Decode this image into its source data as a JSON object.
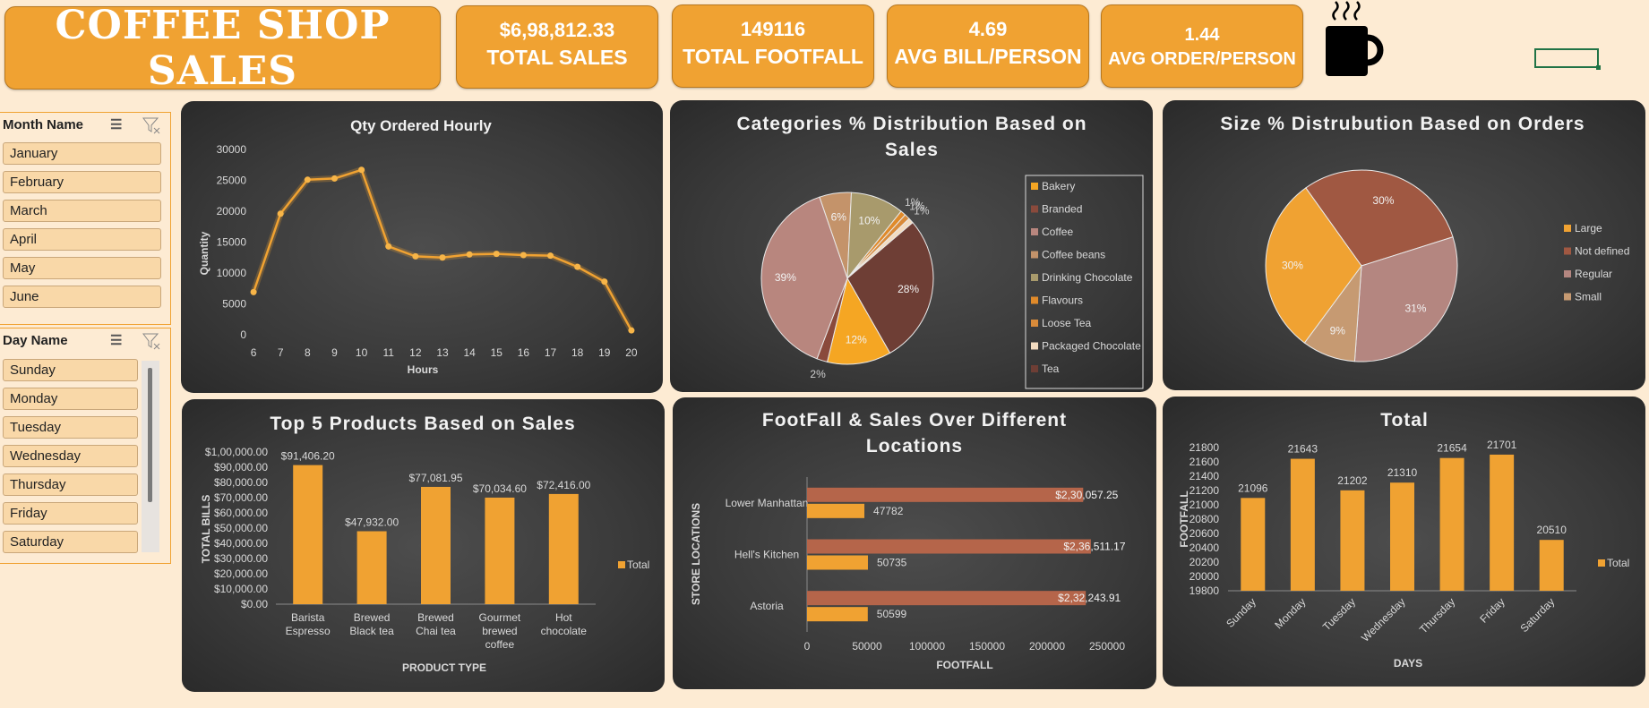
{
  "header": {
    "title": "COFFEE SHOP SALES",
    "kpis": [
      {
        "value": "$6,98,812.33",
        "label": "TOTAL SALES"
      },
      {
        "value": "149116",
        "label": "TOTAL FOOTFALL"
      },
      {
        "value": "4.69",
        "label": "AVG BILL/PERSON"
      },
      {
        "value": "1.44",
        "label": "AVG ORDER/PERSON"
      }
    ]
  },
  "slicers": {
    "month": {
      "title": "Month Name",
      "items": [
        "January",
        "February",
        "March",
        "April",
        "May",
        "June"
      ]
    },
    "day": {
      "title": "Day Name",
      "items": [
        "Sunday",
        "Monday",
        "Tuesday",
        "Wednesday",
        "Thursday",
        "Friday",
        "Saturday"
      ]
    }
  },
  "colors": {
    "accent": "#f0a232",
    "background": "#fdebd3",
    "panel": "#404040"
  },
  "chart_data": [
    {
      "id": "hourly",
      "type": "line",
      "title": "Qty Ordered Hourly",
      "xlabel": "Hours",
      "ylabel": "Quantity",
      "x": [
        "6",
        "7",
        "8",
        "9",
        "10",
        "11",
        "12",
        "13",
        "14",
        "15",
        "16",
        "17",
        "18",
        "19",
        "20"
      ],
      "values": [
        6900,
        19600,
        25100,
        25300,
        26700,
        14300,
        12700,
        12500,
        13000,
        13100,
        12900,
        12800,
        11000,
        8600,
        700
      ],
      "yticks": [
        "0",
        "5000",
        "10000",
        "15000",
        "20000",
        "25000",
        "30000"
      ],
      "ylim": [
        0,
        30000
      ]
    },
    {
      "id": "categories",
      "type": "pie",
      "title": "Categories % Distribution Based on Sales",
      "title_lines": [
        "Categories % Distribution Based on",
        "Sales"
      ],
      "legend_position": "right",
      "slices": [
        {
          "name": "Bakery",
          "value": 12,
          "label": "12%",
          "color": "#f5a623"
        },
        {
          "name": "Branded",
          "value": 2,
          "label": "2%",
          "color": "#8a4a3c"
        },
        {
          "name": "Coffee",
          "value": 39,
          "label": "39%",
          "color": "#b8867e"
        },
        {
          "name": "Coffee beans",
          "value": 6,
          "label": "6%",
          "color": "#c4936a"
        },
        {
          "name": "Drinking Chocolate",
          "value": 10,
          "label": "10%",
          "color": "#a89a6c"
        },
        {
          "name": "Flavours",
          "value": 1,
          "label": "1%",
          "color": "#e08a2a"
        },
        {
          "name": "Loose Tea",
          "value": 1,
          "label": "1%",
          "color": "#d98b3a"
        },
        {
          "name": "Packaged Chocolate",
          "value": 1,
          "label": "1%",
          "color": "#f3dcc0"
        },
        {
          "name": "Tea",
          "value": 28,
          "label": "28%",
          "color": "#6e3e35"
        }
      ]
    },
    {
      "id": "sizes",
      "type": "pie",
      "title": "Size % Distrubution Based on Orders",
      "legend_position": "right",
      "slices": [
        {
          "name": "Large",
          "value": 30,
          "label": "30%",
          "color": "#f0a232"
        },
        {
          "name": "Not defined",
          "value": 30,
          "label": "30%",
          "color": "#a05842"
        },
        {
          "name": "Regular",
          "value": 31,
          "label": "31%",
          "color": "#b48680"
        },
        {
          "name": "Small",
          "value": 9,
          "label": "9%",
          "color": "#c69a72"
        }
      ]
    },
    {
      "id": "products",
      "type": "bar",
      "title": "Top 5 Products Based on Sales",
      "xlabel": "PRODUCT TYPE",
      "ylabel": "TOTAL BILLS",
      "categories": [
        [
          "Barista",
          "Espresso"
        ],
        [
          "Brewed",
          "Black tea"
        ],
        [
          "Brewed",
          "Chai tea"
        ],
        [
          "Gourmet",
          "brewed",
          "coffee"
        ],
        [
          "Hot",
          "chocolate"
        ]
      ],
      "values": [
        91406.2,
        47932.0,
        77081.95,
        70034.6,
        72416.0
      ],
      "value_labels": [
        "$91,406.20",
        "$47,932.00",
        "$77,081.95",
        "$70,034.60",
        "$72,416.00"
      ],
      "yticks": [
        "$0.00",
        "$10,000.00",
        "$20,000.00",
        "$30,000.00",
        "$40,000.00",
        "$50,000.00",
        "$60,000.00",
        "$70,000.00",
        "$80,000.00",
        "$90,000.00",
        "$1,00,000.00"
      ],
      "ylim": [
        0,
        100000
      ],
      "legend": "Total"
    },
    {
      "id": "locations",
      "type": "bar",
      "orientation": "horizontal",
      "title": "FootFall & Sales Over Different Locations",
      "title_lines": [
        "FootFall & Sales Over Different",
        "Locations"
      ],
      "xlabel": "FOOTFALL",
      "ylabel": "STORE LOCATIONS",
      "categories": [
        "Lower Manhattan",
        "Hell's Kitchen",
        "Astoria"
      ],
      "series": [
        {
          "values": [
            230057.25,
            236511.17,
            232243.91
          ],
          "labels": [
            "$2,30,057.25",
            "$2,36,511.17",
            "$2,32,243.91"
          ],
          "color": "#b5654a"
        },
        {
          "values": [
            47782,
            50735,
            50599
          ],
          "labels": [
            "47782",
            "50735",
            "50599"
          ],
          "color": "#f0a232"
        }
      ],
      "xticks": [
        "0",
        "50000",
        "100000",
        "150000",
        "200000",
        "250000"
      ],
      "xlim": [
        0,
        250000
      ]
    },
    {
      "id": "days",
      "type": "bar",
      "title": "Total",
      "xlabel": "DAYS",
      "ylabel": "FOOTFALL",
      "categories": [
        "Sunday",
        "Monday",
        "Tuesday",
        "Wednesday",
        "Thursday",
        "Friday",
        "Saturday"
      ],
      "values": [
        21096,
        21643,
        21202,
        21310,
        21654,
        21701,
        20510
      ],
      "yticks": [
        "19800",
        "20000",
        "20200",
        "20400",
        "20600",
        "20800",
        "21000",
        "21200",
        "21400",
        "21600",
        "21800"
      ],
      "ylim": [
        19800,
        21800
      ],
      "legend": "Total"
    }
  ]
}
